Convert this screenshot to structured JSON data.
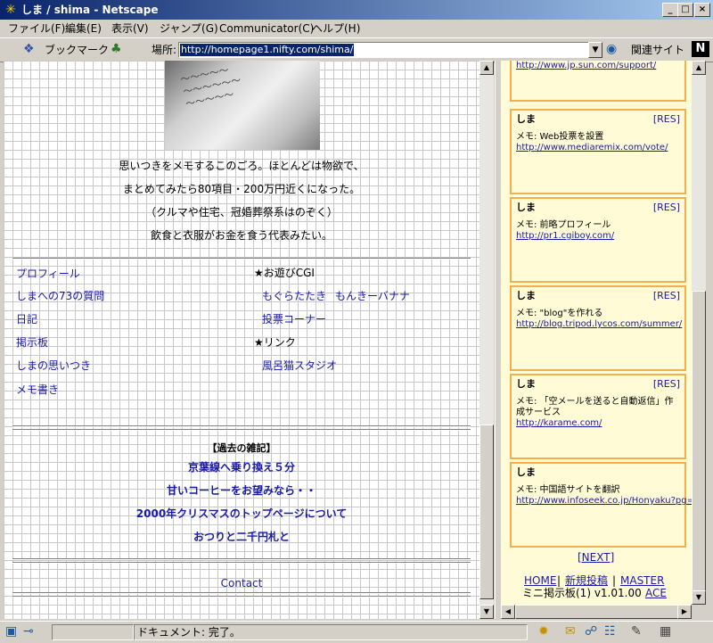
{
  "window": {
    "title": "しま / shima - Netscape"
  },
  "menu": [
    "ファイル(F)",
    "編集(E)",
    "表示(V)",
    "ジャンプ(G)",
    "Communicator(C)",
    "ヘルプ(H)"
  ],
  "toolbar": {
    "bookmark_label": "ブックマーク",
    "location_label": "場所:",
    "url": "http://homepage1.nifty.com/shima/",
    "related_label": "関連サイト",
    "logo": "N"
  },
  "left": {
    "intro": [
      "思いつきをメモするこのごろ。ほとんどは物欲で、",
      "まとめてみたら80項目・200万円近くになった。",
      "（クルマや住宅、冠婚葬祭系はのぞく）",
      "飲食と衣服がお金を食う代表みたい。"
    ],
    "nav_left": [
      "プロフィール",
      "しまへの73の質問",
      "日記",
      "掲示板",
      "しまの思いつき",
      "メモ書き"
    ],
    "cgi_heading": "★お遊びCGI",
    "cgi_links": [
      "もぐらたたき",
      "もんきーバナナ",
      "投票コーナー"
    ],
    "link_heading": "★リンク",
    "link_links": [
      "風呂猫スタジオ"
    ],
    "past_heading": "【過去の雑記】",
    "past_links": [
      "京葉線へ乗り換え５分",
      "甘いコーヒーをお望みなら・・",
      "2000年クリスマスのトップページについて",
      "おつりと二千円札と"
    ],
    "contact": "Contact"
  },
  "board": {
    "top_fragment": "http://www.jp.sun.com/support/",
    "posts": [
      {
        "author": "しま",
        "res": "[RES]",
        "memo": "メモ: Web投票を設置",
        "url": "http://www.mediaremix.com/vote/"
      },
      {
        "author": "しま",
        "res": "[RES]",
        "memo": "メモ: 前略プロフィール",
        "url": "http://pr1.cgiboy.com/"
      },
      {
        "author": "しま",
        "res": "[RES]",
        "memo": "メモ: \"blog\"を作れる",
        "url": "http://blog.tripod.lycos.com/summer/"
      },
      {
        "author": "しま",
        "res": "[RES]",
        "memo": "メモ: 「空メールを送ると自動返信」作成サービス",
        "url": "http://karame.com/"
      },
      {
        "author": "しま",
        "res": "",
        "memo": "メモ: 中国語サイトを翻訳",
        "url": "http://www.infoseek.co.jp/Honyaku?pg=hon"
      }
    ],
    "next": "[NEXT]",
    "home": "HOME",
    "sep": "|",
    "new_post": "新規投稿",
    "master": "MASTER",
    "footer_text": "ミニ掲示板(1) v1.01.00",
    "ace": "ACE"
  },
  "status": {
    "text": "ドキュメント: 完了。"
  }
}
